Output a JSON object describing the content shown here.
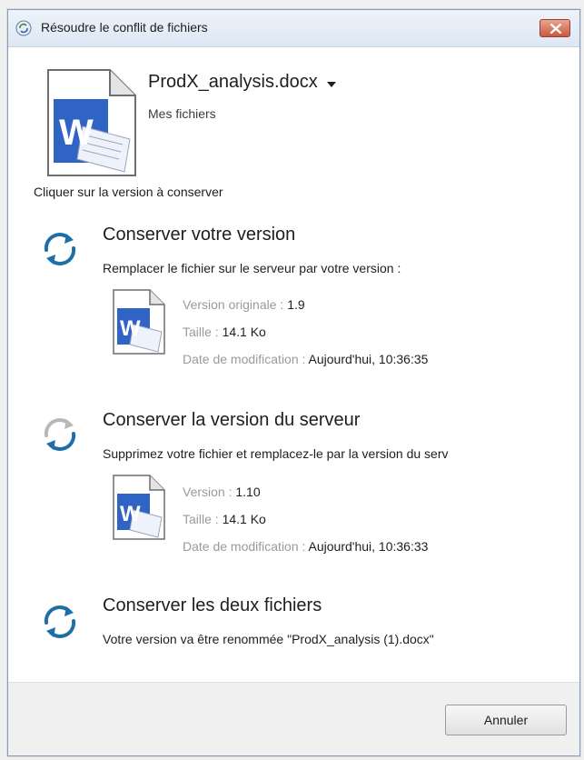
{
  "window": {
    "title": "Résoudre le conflit de fichiers"
  },
  "header": {
    "file_name": "ProdX_analysis.docx",
    "location": "Mes fichiers",
    "instruction": "Cliquer sur la version à conserver"
  },
  "options": [
    {
      "title": "Conserver votre version",
      "description": "Remplacer le fichier sur le serveur par votre version :",
      "meta": [
        {
          "label": "Version originale : ",
          "value": "1.9"
        },
        {
          "label": "Taille : ",
          "value": "14.1 Ko"
        },
        {
          "label": "Date de modification : ",
          "value": "Aujourd'hui, 10:36:35"
        }
      ]
    },
    {
      "title": "Conserver la version du serveur",
      "description": "Supprimez votre fichier et remplacez-le par la version du serv",
      "meta": [
        {
          "label": "Version : ",
          "value": "1.10"
        },
        {
          "label": "Taille : ",
          "value": "14.1 Ko"
        },
        {
          "label": "Date de modification : ",
          "value": "Aujourd'hui, 10:36:33"
        }
      ]
    },
    {
      "title": "Conserver les deux fichiers",
      "description": "Votre version va être renommée \"ProdX_analysis (1).docx\""
    }
  ],
  "footer": {
    "cancel_label": "Annuler"
  },
  "icons": {
    "app": "sync-app-icon",
    "close": "close-icon",
    "word_doc": "word-document-icon",
    "sync": "sync-arrows-icon"
  },
  "colors": {
    "sync_blue": "#1e6fa8",
    "sync_gray": "#b8b8b8",
    "word_blue": "#2b5cb8",
    "close_red": "#c85a40"
  }
}
